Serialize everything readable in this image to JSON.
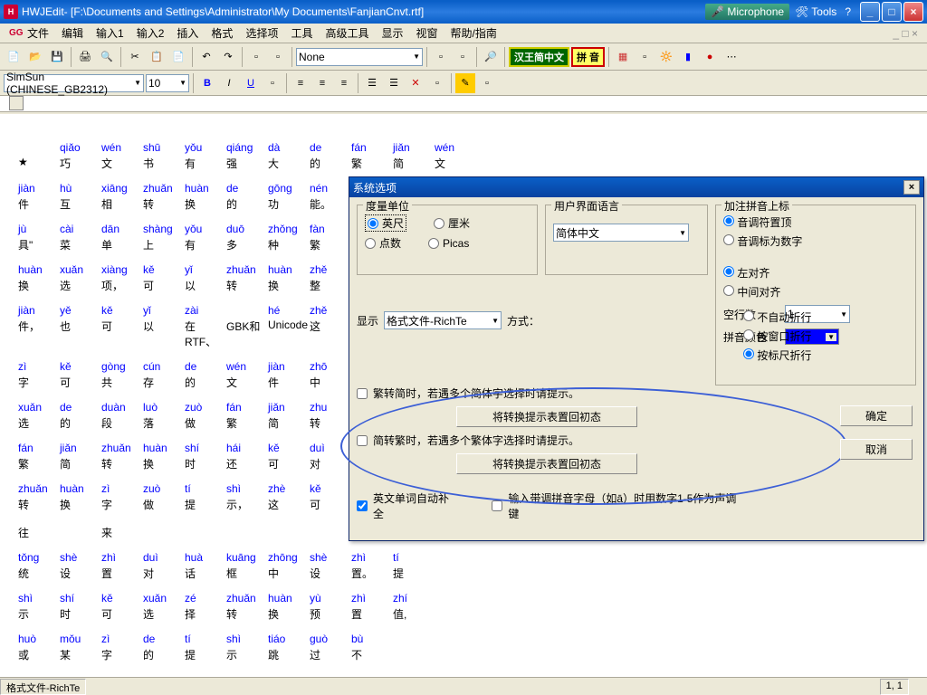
{
  "title": {
    "app": "HWJEdit",
    "path": " - [F:\\Documents and Settings\\Administrator\\My Documents\\FanjianCnvt.rtf]"
  },
  "xptools": {
    "mic": "Microphone",
    "tools": "Tools"
  },
  "menu": [
    "文件",
    "编辑",
    "输入1",
    "输入2",
    "插入",
    "格式",
    "选择项",
    "工具",
    "高级工具",
    "显示",
    "视窗",
    "帮助/指南"
  ],
  "tb": {
    "font_combo": "None",
    "hanbtn1": "汉王简中文",
    "hanbtn2": "拼 音"
  },
  "tb2": {
    "font": "SimSun (CHINESE_GB2312)",
    "size": "10"
  },
  "doc": {
    "rows": [
      [
        [
          "",
          "qiǎo",
          "wén",
          "shū",
          "yǒu",
          "qiáng",
          "dà",
          "de",
          "fán",
          "jiǎn",
          "wén"
        ],
        [
          "★",
          "巧",
          "文",
          "书",
          "有",
          "强",
          "大",
          "的",
          "繁",
          "简",
          "文"
        ]
      ],
      [
        [
          "jiàn",
          "hù",
          "xiāng",
          "zhuǎn",
          "huàn",
          "de",
          "gōng",
          "nén"
        ],
        [
          "件",
          "互",
          "相",
          "转",
          "换",
          "的",
          "功",
          "能。"
        ]
      ],
      [
        [
          "jù",
          "cài",
          "dān",
          "shàng",
          "yǒu",
          "duō",
          "zhǒng",
          "fàn"
        ],
        [
          "具\"",
          "菜",
          "单",
          "上",
          "有",
          "多",
          "种",
          "繁"
        ]
      ],
      [
        [
          "huàn",
          "xuǎn",
          "xiàng",
          "kě",
          "yǐ",
          "zhuǎn",
          "huàn",
          "zhě"
        ],
        [
          "换",
          "选",
          "项，",
          "可",
          "以",
          "转",
          "换",
          "整"
        ]
      ],
      [
        [
          "jiàn",
          "yě",
          "kě",
          "yǐ",
          "zài",
          "",
          "hé",
          "zhě"
        ],
        [
          "件，",
          "也",
          "可",
          "以",
          "在RTF、",
          "GBK和",
          "Unicode",
          "这"
        ]
      ],
      [
        [
          "zì",
          "kě",
          "gòng",
          "cún",
          "de",
          "wén",
          "jiàn",
          "zhō"
        ],
        [
          "字",
          "可",
          "共",
          "存",
          "的",
          "文",
          "件",
          "中"
        ]
      ],
      [
        [
          "xuǎn",
          "de",
          "duàn",
          "luò",
          "zuò",
          "fán",
          "jiǎn",
          "zhu"
        ],
        [
          "选",
          "的",
          "段",
          "落",
          "做",
          "繁",
          "简",
          "转"
        ]
      ],
      [
        [
          "fán",
          "jiǎn",
          "zhuǎn",
          "huàn",
          "shí",
          "hái",
          "kě",
          "duì"
        ],
        [
          "繁",
          "简",
          "转",
          "换",
          "时",
          "还",
          "可",
          "对"
        ]
      ],
      [
        [
          "zhuǎn",
          "huàn",
          "zì",
          "zuò",
          "tí",
          "shì",
          "zhè",
          "kě"
        ],
        [
          "转",
          "换",
          "字",
          "做",
          "提",
          "示，",
          "这",
          "可"
        ]
      ],
      [
        [
          "",
          "",
          "",
          "",
          "",
          "",
          "",
          "",
          ""
        ],
        [
          "往",
          "",
          "来",
          "",
          "",
          "",
          "",
          "",
          ""
        ]
      ],
      [
        [
          "tǒng",
          "shè",
          "zhì",
          "duì",
          "huà",
          "kuāng",
          "zhōng",
          "shè",
          "zhì",
          "tí"
        ],
        [
          "统",
          "设",
          "置",
          "对",
          "话",
          "框",
          "中",
          "设",
          "置。",
          "提"
        ]
      ],
      [
        [
          "shì",
          "shí",
          "kě",
          "xuǎn",
          "zé",
          "zhuǎn",
          "huàn",
          "yù",
          "zhì",
          "zhí"
        ],
        [
          "示",
          "时",
          "可",
          "选",
          "择",
          "转",
          "换",
          "预",
          "置",
          "值,"
        ]
      ],
      [
        [
          "huò",
          "mǒu",
          "zì",
          "de",
          "tí",
          "shì",
          "tiáo",
          "guò",
          "bù"
        ],
        [
          "或",
          "某",
          "字",
          "的",
          "提",
          "示",
          "跳",
          "过",
          "不"
        ]
      ]
    ]
  },
  "dlg": {
    "title": "系统选项",
    "grp1": "度量单位",
    "unit_in": "英尺",
    "unit_cm": "厘米",
    "unit_pt": "点数",
    "unit_pc": "Picas",
    "grp2": "用户界面语言",
    "lang": "简体中文",
    "grp3": "加注拼音上标",
    "py1": "音调符置顶",
    "py2": "音调标为数字",
    "al1": "左对齐",
    "al2": "中间对齐",
    "disp": "显示",
    "disp_combo": "格式文件-RichTe",
    "mode": "方式：",
    "wrap1": "不自动折行",
    "wrap2": "按窗口折行",
    "wrap3": "按标尺折行",
    "blank": "空行数",
    "blank_val": "1",
    "pycolor": "拼音颜色",
    "ck1": "繁转简时，若遇多个简体字选择时请提示。",
    "btn1": "将转换提示表置回初态",
    "ck2": "简转繁时，若遇多个繁体字选择时请提示。",
    "btn2": "将转换提示表置回初态",
    "ck3": "英文单词自动补全",
    "ck4": "输入带调拼音字母（如ā）时用数字1-5作为声调键",
    "ok": "确定",
    "cancel": "取消"
  },
  "status": {
    "left": "格式文件-RichTe",
    "pos": "1, 1"
  }
}
